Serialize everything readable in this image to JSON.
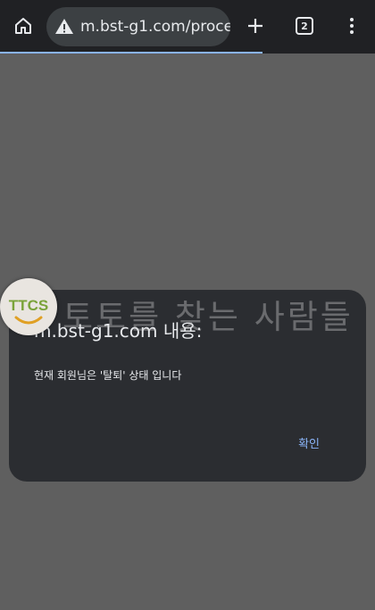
{
  "browser": {
    "url": "m.bst-g1.com/proces",
    "tab_count": "2",
    "icons": {
      "home": "home-icon",
      "warning": "warning-icon",
      "new_tab": "plus-icon",
      "tabs": "tabs-icon",
      "menu": "more-vert-icon"
    }
  },
  "dialog": {
    "title": "m.bst-g1.com 내용:",
    "message": "현재 회원님은 '탈퇴' 상태 입니다",
    "ok_label": "확인"
  },
  "watermark": {
    "logo_text": "TTCS",
    "overlay_text": "토토를 찾는 사람들"
  },
  "colors": {
    "toolbar": "#202124",
    "url_bar": "#3c4043",
    "page_dim": "#5f5f5f",
    "dialog_bg": "#2b2d31",
    "accent": "#8ab4f8"
  }
}
